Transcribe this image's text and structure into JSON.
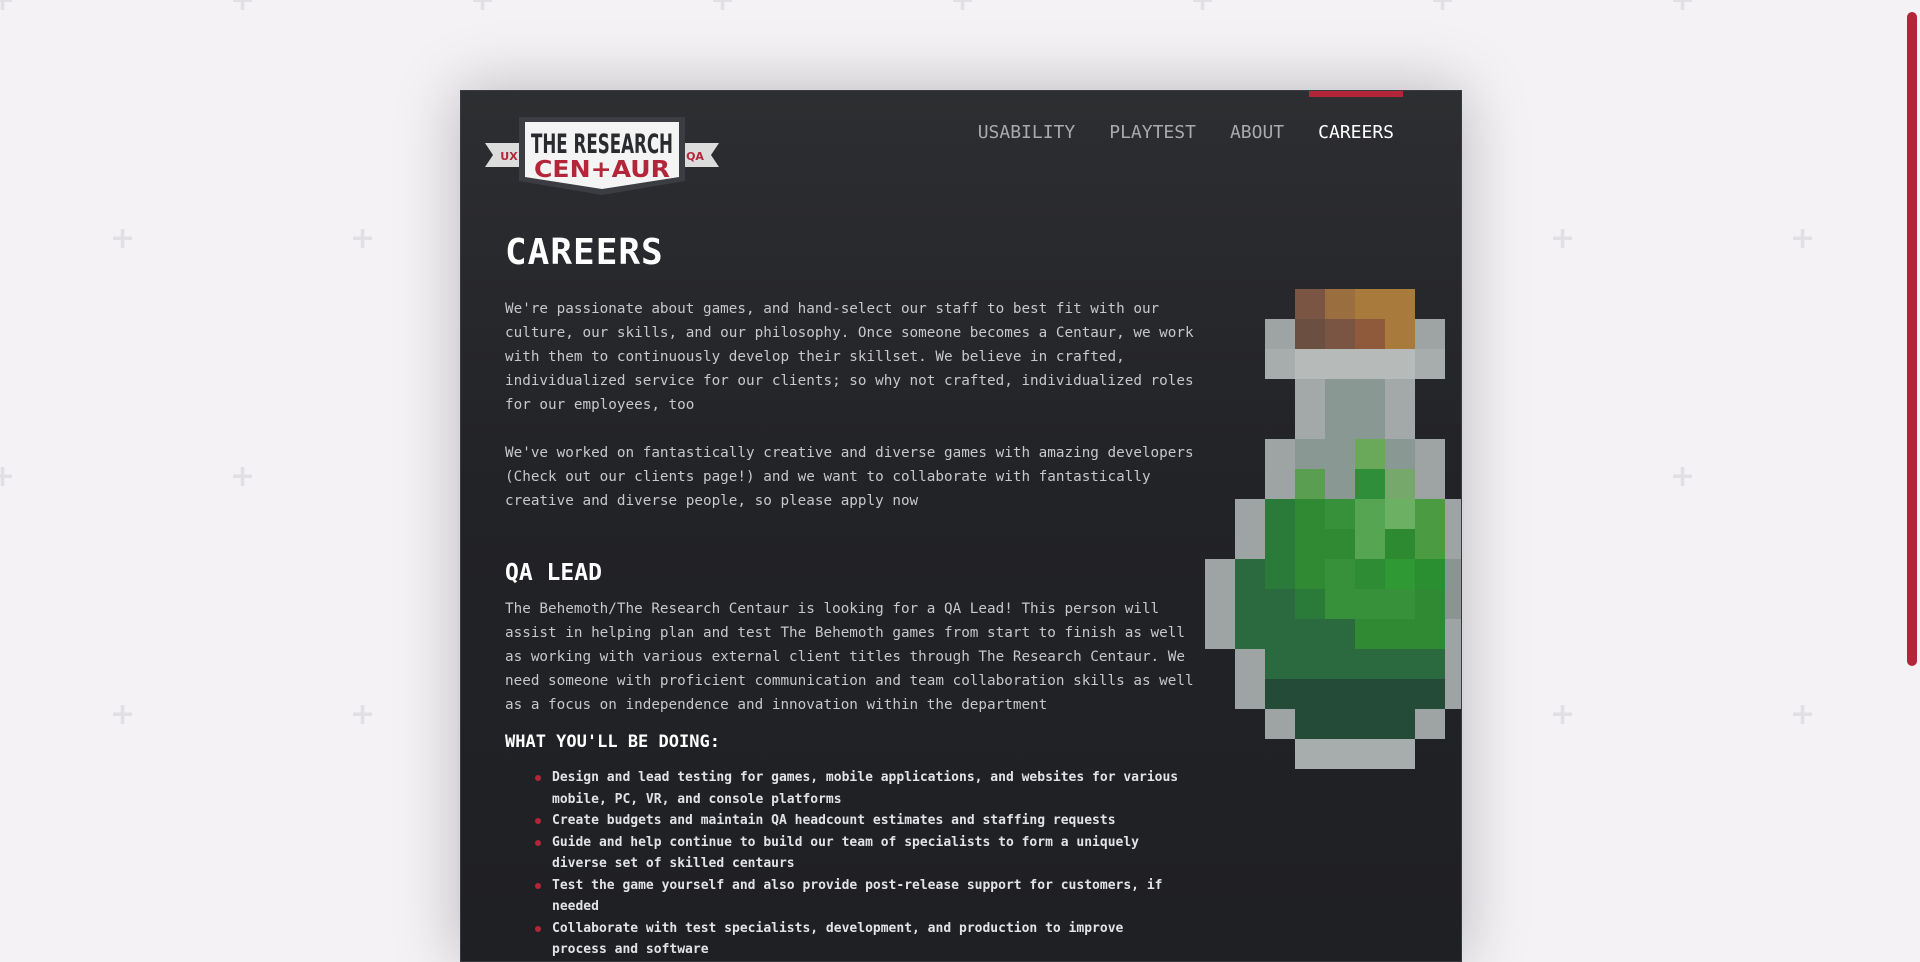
{
  "brand": {
    "line1": "THE RESEARCH",
    "line2": "CEN+AUR",
    "left_tag": "UX",
    "right_tag": "QA",
    "colors": {
      "red": "#b3263a",
      "dark": "#2d2e31"
    }
  },
  "nav": {
    "items": [
      {
        "label": "USABILITY"
      },
      {
        "label": "PLAYTEST"
      },
      {
        "label": "ABOUT"
      },
      {
        "label": "CAREERS",
        "active": true
      }
    ]
  },
  "page": {
    "title": "CAREERS",
    "intro": [
      "We're passionate about games, and hand-select our staff to best fit with our culture, our skills, and our philosophy. Once someone becomes a Centaur, we work with them to continuously develop their skillset. We believe in crafted, individualized service for our clients; so why not crafted, individualized roles for our employees, too",
      "We've worked on fantastically creative and diverse games with amazing developers (Check out our clients page!) and we want to collaborate with fantastically creative and diverse people, so please apply now"
    ]
  },
  "job": {
    "title": "QA LEAD",
    "description": "The Behemoth/The Research Centaur is looking for a QA Lead! This person will assist in helping plan and test The Behemoth games from start to finish as well as working with various external client titles through The Research Centaur. We need someone with proficient communication and team collaboration skills as well as a focus on independence and innovation within the department",
    "duties_heading": "WHAT YOU'LL BE DOING:",
    "duties": [
      "Design and lead testing for games, mobile applications, and websites for various mobile, PC, VR, and console platforms",
      "Create budgets and maintain QA headcount estimates and staffing requests",
      "Guide and help continue to build our team of specialists to form a uniquely diverse set of skilled centaurs",
      "Test the game yourself and also provide post-release support for customers, if needed",
      "Collaborate with test specialists, development, and production to improve process and software"
    ]
  },
  "decor": {
    "potion_icon": "pixel-potion-bottle-icon",
    "background_icon": "plus-cross-pattern",
    "scrollbar_color": "#b3263a"
  }
}
